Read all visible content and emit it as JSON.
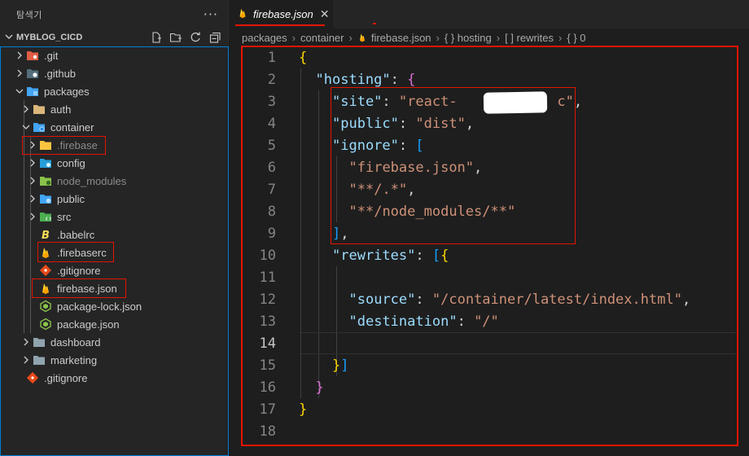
{
  "colors": {
    "folder": "#dcb67a",
    "firebase": "#ffca28",
    "highlight": "#e51400",
    "focus_border": "#007fd4"
  },
  "sidebar": {
    "title": "탐색기",
    "more": "···",
    "section": "MYBLOG_CICD",
    "actions": [
      "new-file-icon",
      "new-folder-icon",
      "refresh-icon",
      "collapse-all-icon"
    ],
    "items": [
      {
        "label": ".git",
        "icon": "git-folder-icon"
      },
      {
        "label": ".github",
        "icon": "github-folder-icon"
      },
      {
        "label": "packages",
        "icon": "packages-folder-icon"
      },
      {
        "label": "auth",
        "icon": "folder-icon"
      },
      {
        "label": "container",
        "icon": "container-folder-icon"
      },
      {
        "label": ".firebase",
        "icon": "folder-icon"
      },
      {
        "label": "config",
        "icon": "config-folder-icon"
      },
      {
        "label": "node_modules",
        "icon": "node-folder-icon"
      },
      {
        "label": "public",
        "icon": "public-folder-icon"
      },
      {
        "label": "src",
        "icon": "src-folder-icon"
      },
      {
        "label": ".babelrc",
        "icon": "babel-icon"
      },
      {
        "label": ".firebaserc",
        "icon": "firebase-icon"
      },
      {
        "label": ".gitignore",
        "icon": "git-file-icon"
      },
      {
        "label": "firebase.json",
        "icon": "firebase-icon"
      },
      {
        "label": "package-lock.json",
        "icon": "nodejs-icon"
      },
      {
        "label": "package.json",
        "icon": "nodejs-icon"
      },
      {
        "label": "dashboard",
        "icon": "folder-icon"
      },
      {
        "label": "marketing",
        "icon": "folder-icon"
      },
      {
        "label": ".gitignore",
        "icon": "git-file-icon"
      }
    ]
  },
  "editor": {
    "tab": {
      "label": "firebase.json",
      "close": "✕",
      "icon": "firebase-icon"
    },
    "breadcrumb": [
      "packages",
      "container",
      "firebase.json",
      "{ } hosting",
      "[ ] rewrites",
      "{ } 0"
    ],
    "current_line": 14,
    "lines": [
      {
        "n": "1",
        "t": "{"
      },
      {
        "n": "2",
        "t": "  \"hosting\": {"
      },
      {
        "n": "3",
        "t": "    \"site\": \"react-            c\","
      },
      {
        "n": "4",
        "t": "    \"public\": \"dist\","
      },
      {
        "n": "5",
        "t": "    \"ignore\": ["
      },
      {
        "n": "6",
        "t": "      \"firebase.json\","
      },
      {
        "n": "7",
        "t": "      \"**/.*\","
      },
      {
        "n": "8",
        "t": "      \"**/node_modules/**\""
      },
      {
        "n": "9",
        "t": "    ],"
      },
      {
        "n": "10",
        "t": "    \"rewrites\": [{"
      },
      {
        "n": "11",
        "t": ""
      },
      {
        "n": "12",
        "t": "      \"source\": \"/container/latest/index.html\","
      },
      {
        "n": "13",
        "t": "      \"destination\": \"/\""
      },
      {
        "n": "14",
        "t": ""
      },
      {
        "n": "15",
        "t": "    }]"
      },
      {
        "n": "16",
        "t": "  }"
      },
      {
        "n": "17",
        "t": "}"
      },
      {
        "n": "18",
        "t": ""
      }
    ]
  }
}
